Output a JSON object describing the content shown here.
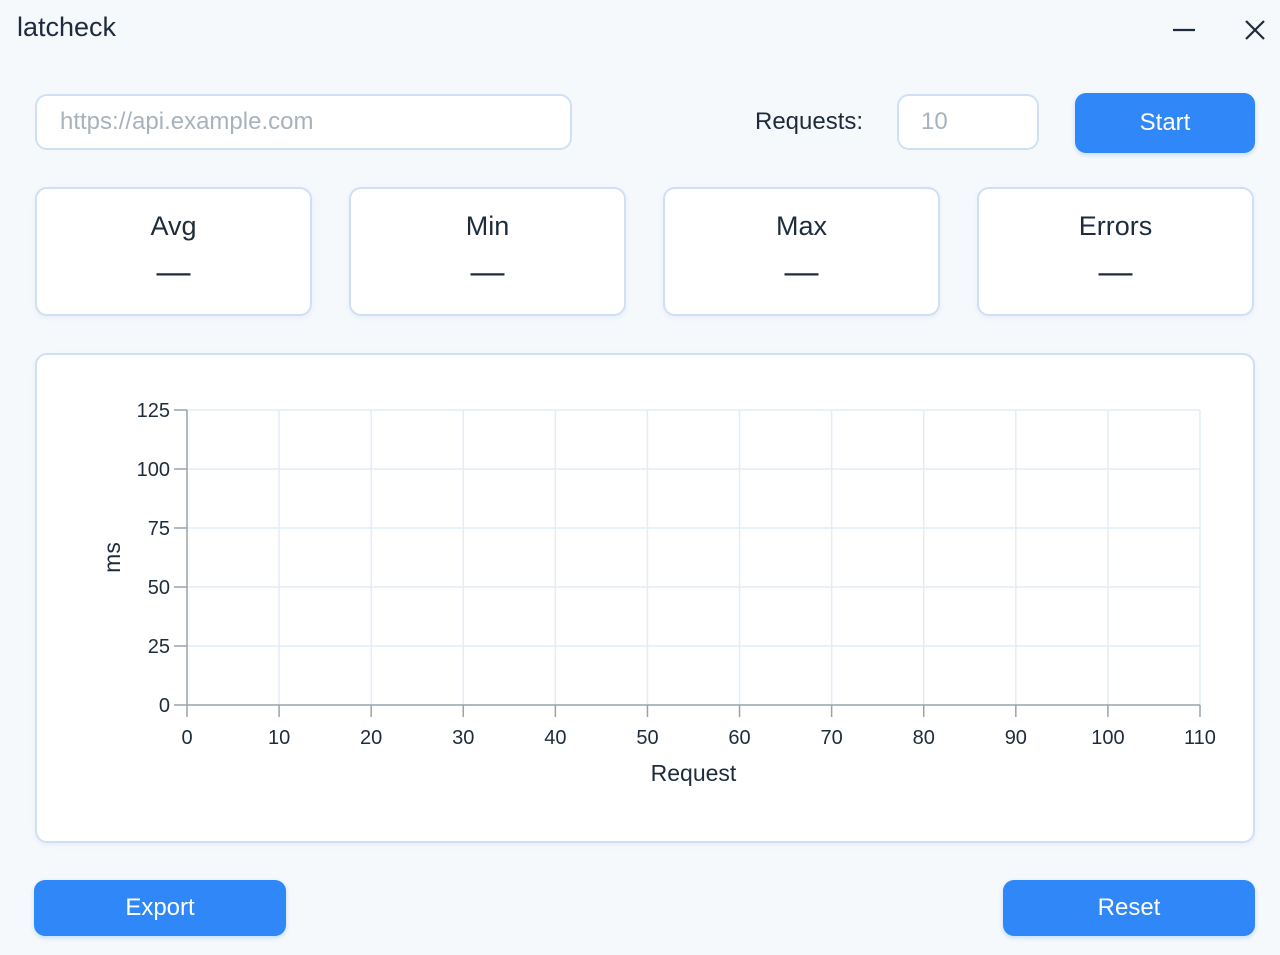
{
  "window": {
    "title": "latcheck",
    "minimize_icon": "minimize-icon",
    "close_icon": "close-icon"
  },
  "controls": {
    "url_placeholder": "https://api.example.com",
    "url_value": "",
    "requests_label": "Requests:",
    "requests_placeholder": "10",
    "requests_value": "",
    "start_label": "Start"
  },
  "stats": [
    {
      "label": "Avg",
      "value": "—"
    },
    {
      "label": "Min",
      "value": "—"
    },
    {
      "label": "Max",
      "value": "—"
    },
    {
      "label": "Errors",
      "value": "—"
    }
  ],
  "chart_data": {
    "type": "line",
    "title": "",
    "xlabel": "Request",
    "ylabel": "ms",
    "xlim": [
      0,
      110
    ],
    "ylim": [
      0,
      125
    ],
    "x_ticks": [
      0,
      10,
      20,
      30,
      40,
      50,
      60,
      70,
      80,
      90,
      100,
      110
    ],
    "y_ticks": [
      0,
      25,
      50,
      75,
      100,
      125
    ],
    "grid": true,
    "series": []
  },
  "footer": {
    "export_label": "Export",
    "reset_label": "Reset"
  },
  "colors": {
    "accent": "#2f87f8",
    "background": "#f6f9fc",
    "border": "#cfe0f5",
    "grid": "#e3edf7",
    "text": "#1e2b3c"
  }
}
